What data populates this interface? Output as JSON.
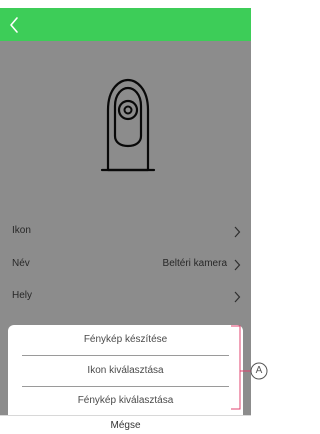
{
  "colors": {
    "header_green": "#3dcd58",
    "overlay": "rgba(0,0,0,0.45)",
    "callout_pink": "#e0436f"
  },
  "header": {
    "back_icon": "chevron-left-icon"
  },
  "device": {
    "icon": "indoor-camera-icon"
  },
  "settings": {
    "rows": [
      {
        "label": "Ikon",
        "value": ""
      },
      {
        "label": "Név",
        "value": "Beltéri kamera"
      },
      {
        "label": "Hely",
        "value": ""
      }
    ]
  },
  "action_sheet": {
    "items": [
      "Fénykép készítése",
      "Ikon kiválasztása",
      "Fénykép kiválasztása"
    ],
    "cancel_label": "Mégse"
  },
  "annotation": {
    "letter": "A"
  }
}
